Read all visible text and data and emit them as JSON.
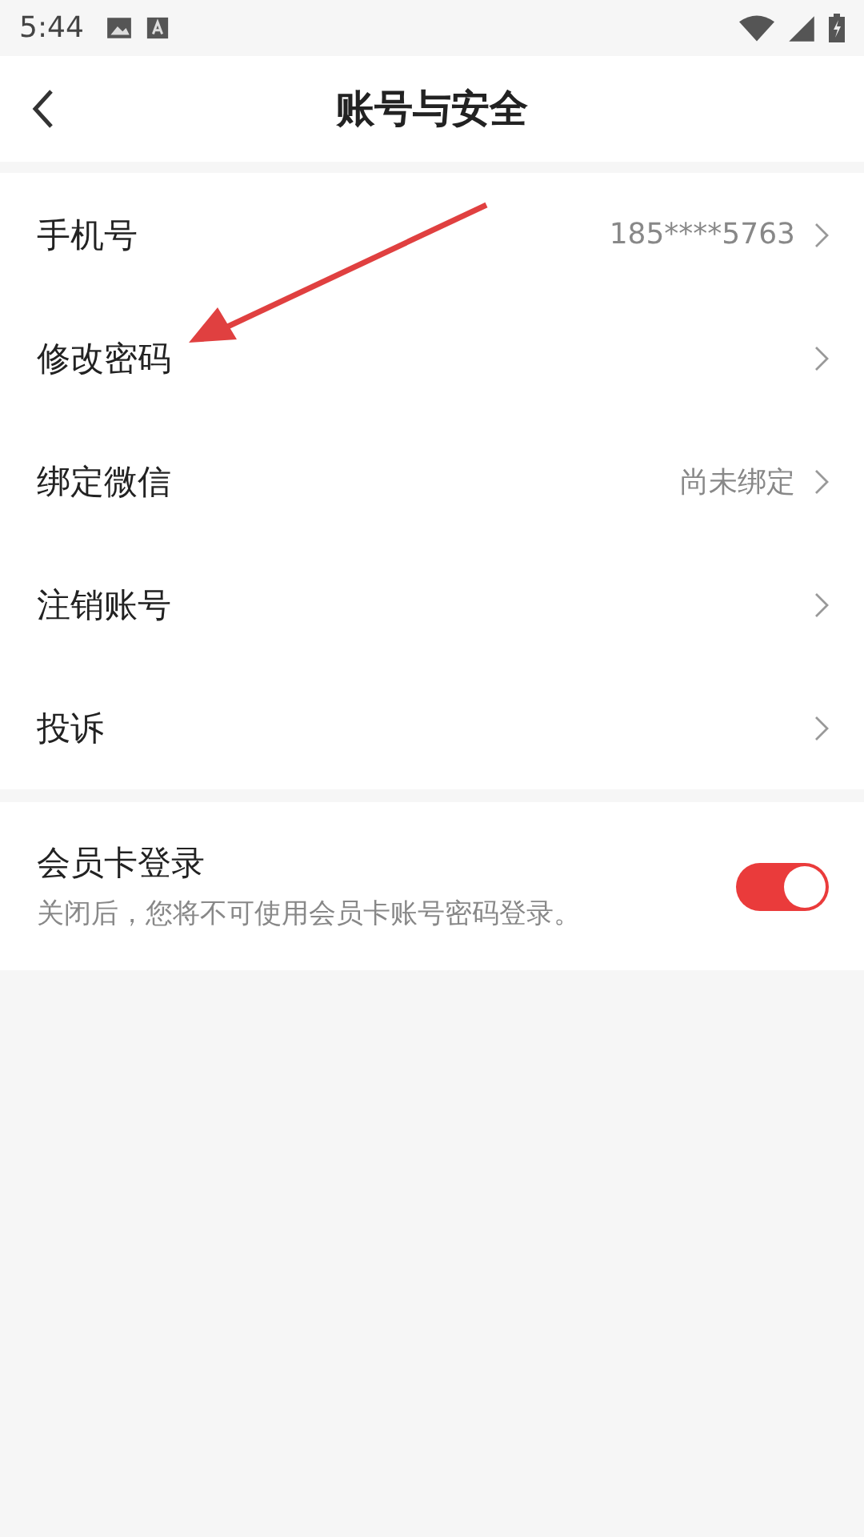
{
  "status_bar": {
    "time": "5:44"
  },
  "header": {
    "title": "账号与安全"
  },
  "rows": [
    {
      "label": "手机号",
      "value": "185****5763"
    },
    {
      "label": "修改密码"
    },
    {
      "label": "绑定微信",
      "value": "尚未绑定"
    },
    {
      "label": "注销账号"
    },
    {
      "label": "投诉"
    }
  ],
  "toggle_row": {
    "title": "会员卡登录",
    "description": "关闭后，您将不可使用会员卡账号密码登录。",
    "on": true
  }
}
